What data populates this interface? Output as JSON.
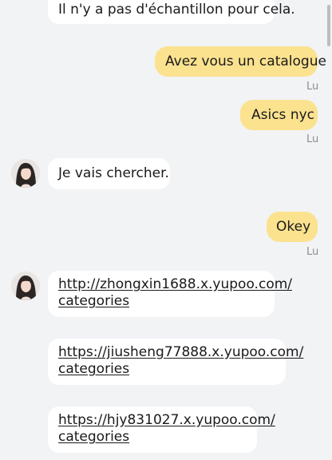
{
  "messages": {
    "m1": {
      "text": "Il n'y a pas d'échantillon pour cela."
    },
    "m2": {
      "text": "Avez vous un catalogue",
      "status": "Lu"
    },
    "m3": {
      "text": "Asics nyc",
      "status": "Lu"
    },
    "m4": {
      "text": "Je vais chercher."
    },
    "m5": {
      "text": "Okey",
      "status": "Lu"
    },
    "m6": {
      "line1": "http://zhongxin1688.x.yupoo.com/",
      "line2": "categories"
    },
    "m7": {
      "line1": "https://jiusheng77888.x.yupoo.com/",
      "line2": "categories"
    },
    "m8": {
      "line1": "https://hjy831027.x.yupoo.com/",
      "line2": "categories"
    }
  },
  "colors": {
    "background": "#f2f3f5",
    "incoming_bubble": "#ffffff",
    "outgoing_bubble": "#fbe28f",
    "read_status": "#8e8e93"
  },
  "icons": {
    "avatar": "contact-avatar-icon"
  }
}
